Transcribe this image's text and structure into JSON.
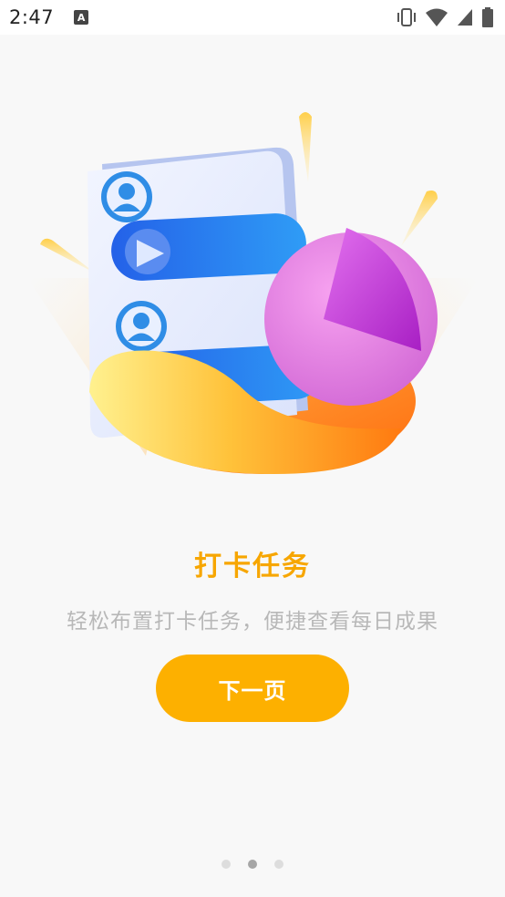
{
  "status_bar": {
    "time": "2:47",
    "notification_icon": "a-letter-icon",
    "icons": [
      "vibrate-icon",
      "wifi-icon",
      "signal-icon",
      "battery-icon"
    ]
  },
  "onboarding": {
    "title": "打卡任务",
    "subtitle": "轻松布置打卡任务，便捷查看每日成果",
    "next_button_label": "下一页",
    "page_indicator": {
      "total": 3,
      "current": 2
    }
  },
  "colors": {
    "accent": "#fdb000",
    "title": "#f7a600",
    "subtitle": "#b8b8b8",
    "background": "#f8f8f8"
  }
}
